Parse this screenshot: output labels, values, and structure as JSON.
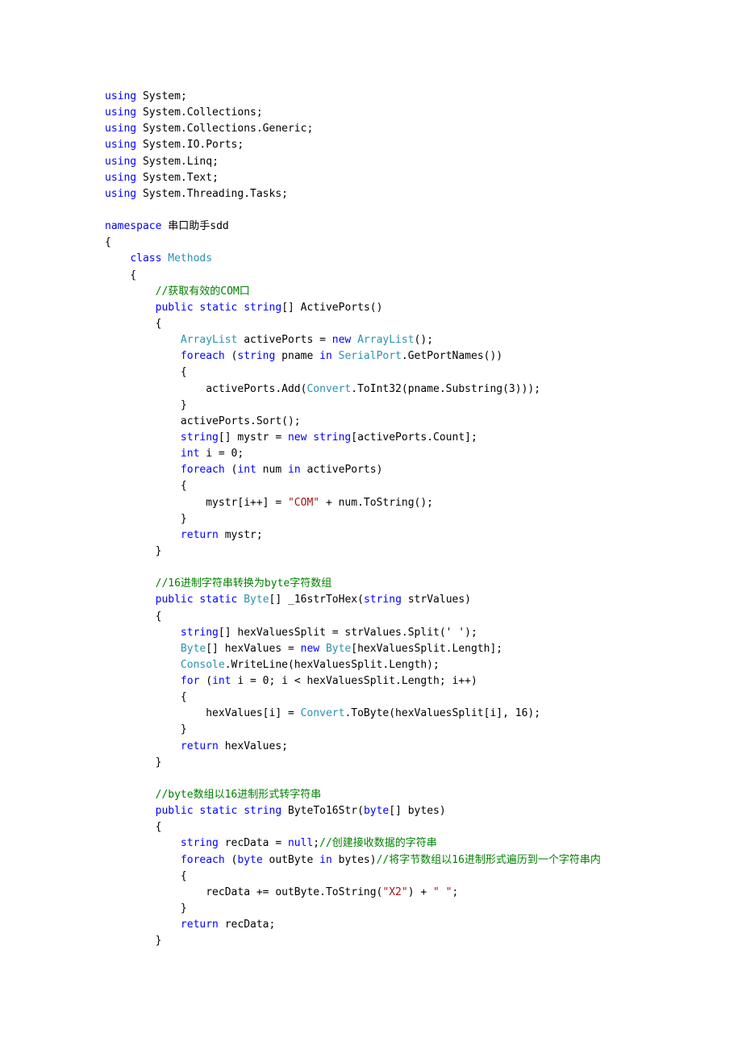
{
  "usings": [
    "System",
    "System.Collections",
    "System.Collections.Generic",
    "System.IO.Ports",
    "System.Linq",
    "System.Text",
    "System.Threading.Tasks"
  ],
  "ns_kw": "namespace",
  "namespace": "串口助手sdd",
  "class_kw": "class",
  "class_name": "Methods",
  "using_kw": "using",
  "m1": {
    "comment": "//获取有效的COM口",
    "sig_public": "public",
    "sig_static": "static",
    "sig_ret": "string",
    "sig_name": "ActivePorts()",
    "l1_a": "ArrayList",
    "l1_b": "activePorts = ",
    "l1_c": "new",
    "l1_d": "ArrayList",
    "l1_e": "();",
    "l2_a": "foreach",
    "l2_b": "(",
    "l2_c": "string",
    "l2_d": " pname ",
    "l2_e": "in",
    "l2_f": "SerialPort",
    "l2_g": ".GetPortNames())",
    "l3_a": "activePorts.Add(",
    "l3_b": "Convert",
    "l3_c": ".ToInt32(pname.Substring(3)));",
    "l4": "activePorts.Sort();",
    "l5_a": "string",
    "l5_b": "[] mystr = ",
    "l5_c": "new",
    "l5_d": "string",
    "l5_e": "[activePorts.Count];",
    "l6_a": "int",
    "l6_b": " i = 0;",
    "l7_a": "foreach",
    "l7_b": "(",
    "l7_c": "int",
    "l7_d": " num ",
    "l7_e": "in",
    "l7_f": " activePorts)",
    "l8_a": "mystr[i++] = ",
    "l8_b": "\"COM\"",
    "l8_c": " + num.ToString();",
    "l9_a": "return",
    "l9_b": " mystr;"
  },
  "m2": {
    "comment": "//16进制字符串转换为byte字符数组",
    "sig_public": "public",
    "sig_static": "static",
    "sig_ret": "Byte",
    "sig_name": "[] _16strToHex(",
    "sig_p1": "string",
    "sig_p2": " strValues)",
    "l1_a": "string",
    "l1_b": "[] hexValuesSplit = strValues.Split(' ');",
    "l2_a": "Byte",
    "l2_b": "[] hexValues = ",
    "l2_c": "new",
    "l2_d": "Byte",
    "l2_e": "[hexValuesSplit.Length];",
    "l3_a": "Console",
    "l3_b": ".WriteLine(hexValuesSplit.Length);",
    "l4_a": "for",
    "l4_b": "(",
    "l4_c": "int",
    "l4_d": " i = 0; i < hexValuesSplit.Length; i++)",
    "l5_a": "hexValues[i] = ",
    "l5_b": "Convert",
    "l5_c": ".ToByte(hexValuesSplit[i], 16);",
    "l6_a": "return",
    "l6_b": " hexValues;"
  },
  "m3": {
    "comment": "//byte数组以16进制形式转字符串",
    "sig_public": "public",
    "sig_static": "static",
    "sig_ret": "string",
    "sig_name": " ByteTo16Str(",
    "sig_p1": "byte",
    "sig_p2": "[] bytes)",
    "l1_a": "string",
    "l1_b": " recData = ",
    "l1_c": "null",
    "l1_d": ";",
    "l1_cmt": "//创建接收数据的字符串",
    "l2_a": "foreach",
    "l2_b": "(",
    "l2_c": "byte",
    "l2_d": " outByte ",
    "l2_e": "in",
    "l2_f": " bytes)",
    "l2_cmt": "//将字节数组以16进制形式遍历到一个字符串内",
    "l3_a": "recData += outByte.ToString(",
    "l3_b": "\"X2\"",
    "l3_c": ") + ",
    "l3_d": "\" \"",
    "l3_e": ";",
    "l4_a": "return",
    "l4_b": " recData;"
  }
}
